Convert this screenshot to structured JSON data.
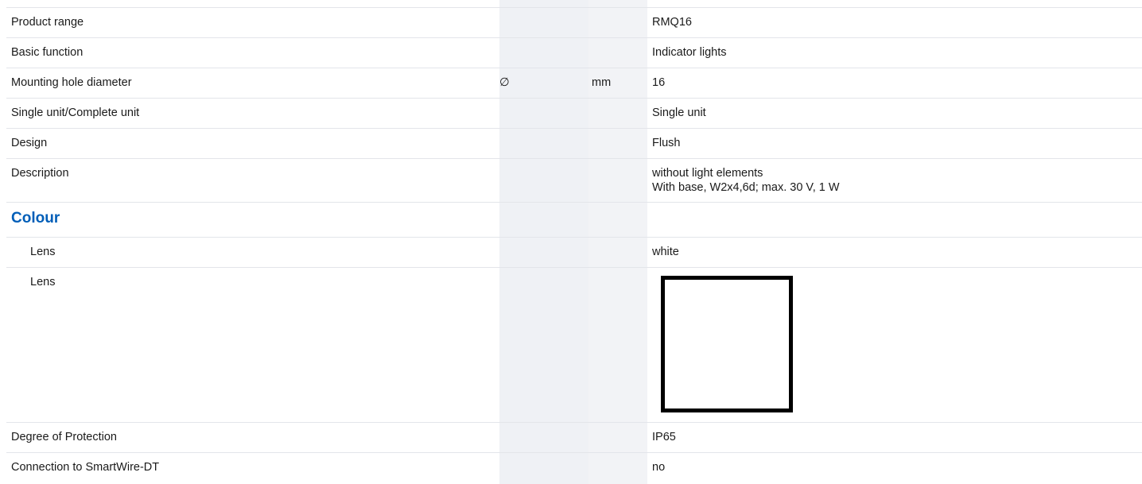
{
  "rows_top": [
    {
      "label": "Product range",
      "symbol": "",
      "unit": "",
      "value": "RMQ16"
    },
    {
      "label": "Basic function",
      "symbol": "",
      "unit": "",
      "value": "Indicator lights"
    },
    {
      "label": "Mounting hole diameter",
      "symbol": "∅",
      "unit": "mm",
      "value": "16"
    },
    {
      "label": "Single unit/Complete unit",
      "symbol": "",
      "unit": "",
      "value": "Single unit"
    },
    {
      "label": "Design",
      "symbol": "",
      "unit": "",
      "value": "Flush"
    },
    {
      "label": "Description",
      "symbol": "",
      "unit": "",
      "value_line1": "without light elements",
      "value_line2": "With base, W2x4,6d; max. 30 V, 1 W"
    }
  ],
  "colour_section": {
    "title": "Colour",
    "lens_text_label": "Lens",
    "lens_text_value": "white",
    "lens_swatch_label": "Lens",
    "lens_swatch_color": "#ffffff"
  },
  "rows_bottom": [
    {
      "label": "Degree of Protection",
      "value": "IP65"
    },
    {
      "label": "Connection to SmartWire-DT",
      "value": "no"
    }
  ]
}
